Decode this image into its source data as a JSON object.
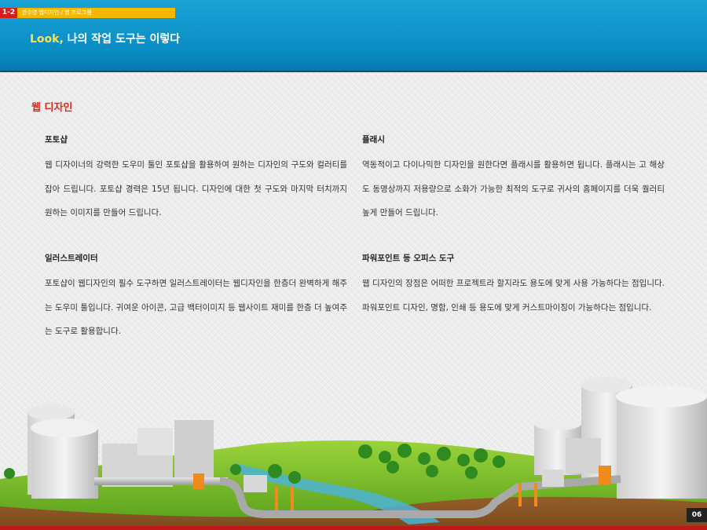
{
  "header": {
    "section_number": "1-2",
    "breadcrumb": "한수영 웹디자인  / 웹 프로그램",
    "title_accent": "Look,",
    "title_rest": " 나의 작업 도구는 이렇다"
  },
  "main": {
    "section_title": "웹 디자인",
    "blocks": [
      {
        "heading": "포토샵",
        "body": "웹 디자이너의 강력한 도우미 툴인 포토샵을 활용하여 원하는 디자인의 구도와 컬러티를 잡아 드립니다. 포토샵 경력은 15년 됩니다.  디자인에 대한 첫 구도와 마지막 터치까지 원하는 이미지를 만들어 드립니다."
      },
      {
        "heading": "플래시",
        "body": "역동적이고 다이나믹한 디자인을 원한다면 플래시를 활용하면 됩니다. 플래시는 고 해상도 동영상까지 저용량으로 소화가 가능한 최적의 도구로 귀사의 홈페이지를 더욱 퀄러티 높게 만들어 드립니다."
      },
      {
        "heading": "일러스트레이터",
        "body": "포토샵이 웹디자인의 필수 도구하면 일러스트레이터는 웹디자인을 한층더 완벽하게 해주는 도우미 툴입니다. 귀여운 아이콘, 고급 백터이미지 등 웹사이트 재미를 한층 더  높여주는 도구로 활용합니다."
      },
      {
        "heading": "파워포인트 등 오피스 도구",
        "body": "웹 디자인의 장점은 어떠한 프로젝트라 할지라도 용도에 맞게 사용 가능하다는 점입니다. 파워포인트 디자인, 명함, 인쇄 등 용도에 맞게 커스트마이징이 가능하다는 점입니다."
      }
    ]
  },
  "footer": {
    "page_number": "06"
  },
  "colors": {
    "header_blue": "#0a8cc4",
    "accent_yellow": "#ffe04a",
    "section_red": "#e0291b",
    "crumb_yellow": "#f5b800"
  }
}
